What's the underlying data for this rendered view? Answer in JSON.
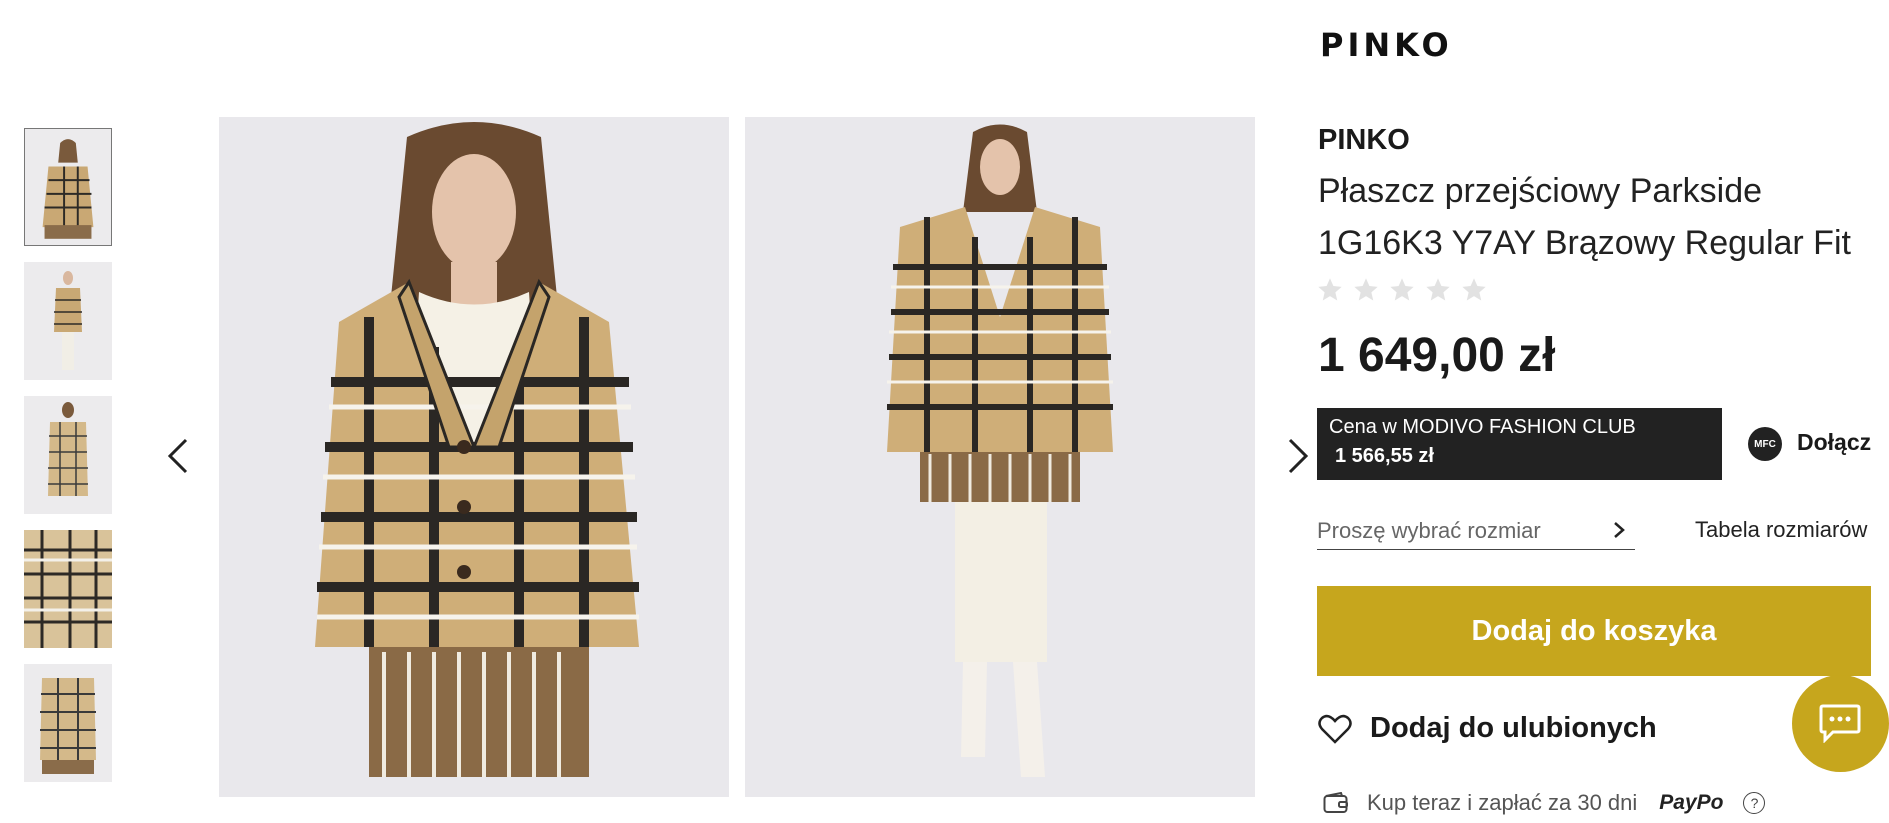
{
  "brand": {
    "logo": "PINKO",
    "name": "PINKO"
  },
  "product": {
    "title": "Płaszcz przejściowy Parkside 1G16K3 Y7AY Brązowy Regular Fit",
    "rating_stars": 5,
    "rating_value": 0,
    "price": "1 649,00 zł"
  },
  "club": {
    "label": "Cena w MODIVO FASHION CLUB",
    "price": "1 566,55 zł",
    "badge": "MFC",
    "join_label": "Dołącz"
  },
  "size": {
    "placeholder": "Proszę wybrać rozmiar",
    "table_link": "Tabela rozmiarów"
  },
  "actions": {
    "add_to_cart": "Dodaj do koszyka",
    "add_to_wishlist": "Dodaj do ulubionych"
  },
  "payment": {
    "text": "Kup teraz i zapłać za 30 dni",
    "logo": "PayPo",
    "help_symbol": "?"
  },
  "gallery": {
    "thumbnail_count": 5,
    "selected_thumbnail": 1,
    "prev_icon": "chevron-left-icon",
    "next_icon": "chevron-right-icon"
  },
  "colors": {
    "accent": "#c6a61d",
    "club_bg": "#222222",
    "image_bg": "#e9e8ec",
    "star_empty": "#e2e2e2"
  }
}
